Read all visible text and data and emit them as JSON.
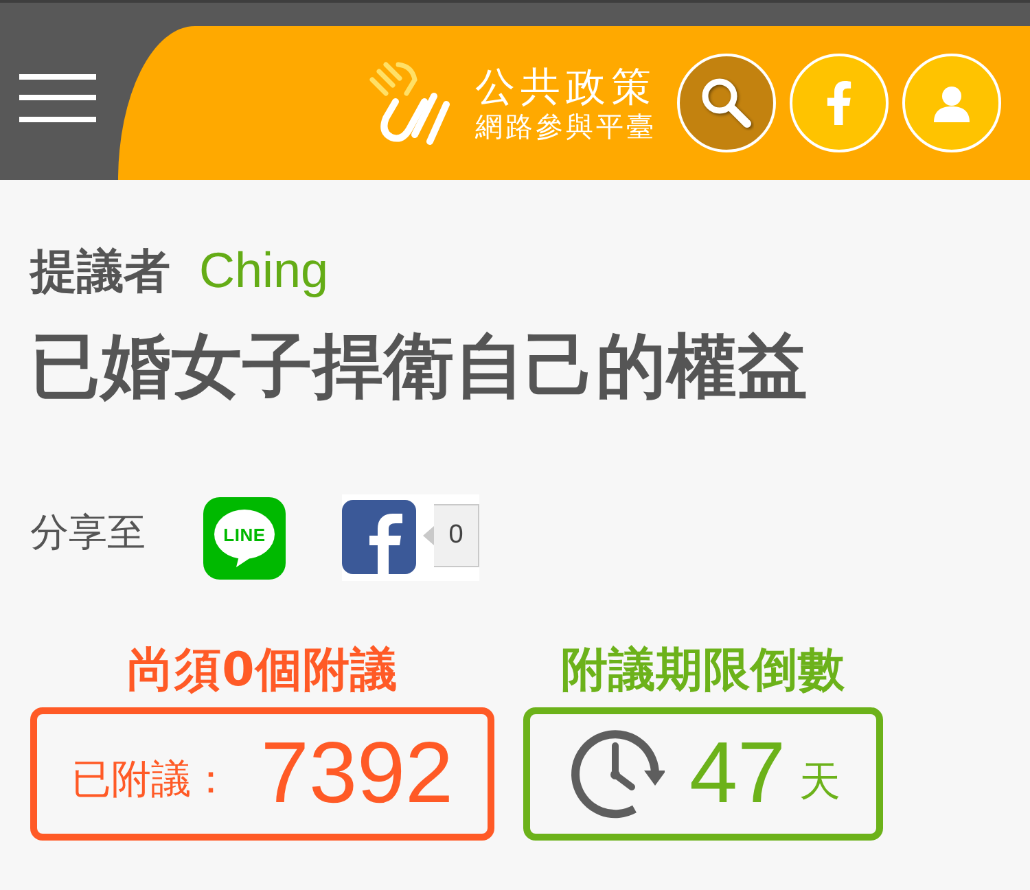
{
  "header": {
    "logo": {
      "title": "公共政策",
      "subtitle": "網路參與平臺"
    },
    "actions": [
      {
        "kind": "search"
      },
      {
        "kind": "facebook"
      },
      {
        "kind": "user"
      }
    ]
  },
  "proposal": {
    "proposer_label": "提議者",
    "proposer": "Ching",
    "title": "已婚女子捍衛自己的權益"
  },
  "share": {
    "label": "分享至",
    "targets": [
      {
        "kind": "line",
        "label": "LINE"
      },
      {
        "kind": "facebook",
        "count": "0"
      }
    ]
  },
  "stats": [
    {
      "kind": "signatures",
      "heading": "尚須0個附議",
      "label": "已附議：",
      "value": "7392"
    },
    {
      "kind": "countdown",
      "heading": "附議期限倒數",
      "value": "47",
      "unit": "天"
    }
  ]
}
